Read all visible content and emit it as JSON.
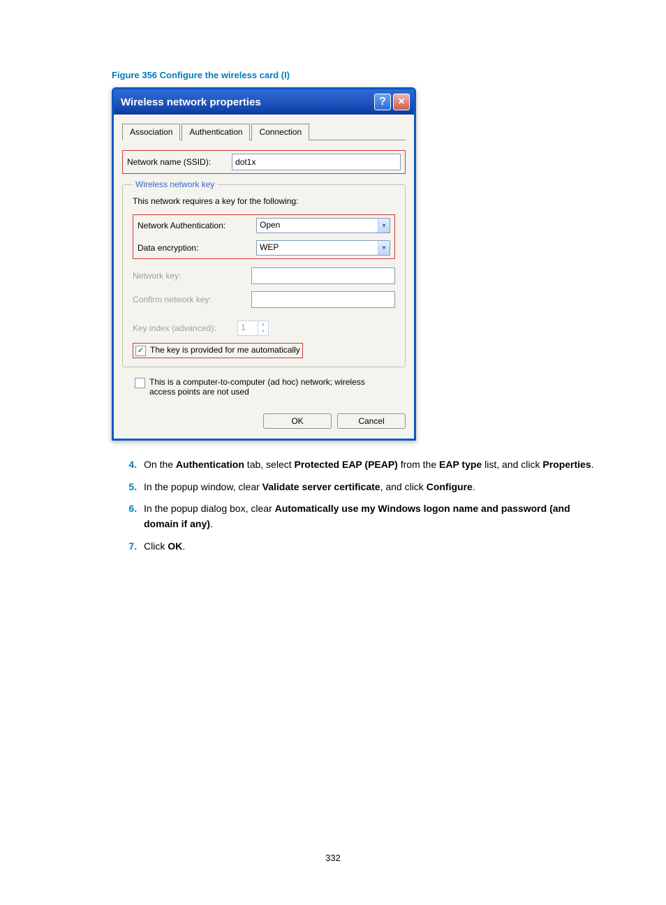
{
  "figure_caption": "Figure 356 Configure the wireless card (I)",
  "dialog": {
    "title": "Wireless network properties",
    "tabs": [
      "Association",
      "Authentication",
      "Connection"
    ],
    "ssid_label": "Network name (SSID):",
    "ssid_value": "dot1x",
    "group_title": "Wireless network key",
    "group_text": "This network requires a key for the following:",
    "auth_label": "Network Authentication:",
    "auth_value": "Open",
    "enc_label": "Data encryption:",
    "enc_value": "WEP",
    "key_label": "Network key:",
    "confirm_label": "Confirm network key:",
    "keyindex_label": "Key index (advanced):",
    "keyindex_value": "1",
    "autokey_label": "The key is provided for me automatically",
    "adhoc_label": "This is a computer-to-computer (ad hoc) network; wireless access points are not used",
    "ok_label": "OK",
    "cancel_label": "Cancel"
  },
  "steps": {
    "s4_a": "On the ",
    "s4_b": "Authentication",
    "s4_c": " tab, select ",
    "s4_d": "Protected EAP (PEAP)",
    "s4_e": " from the ",
    "s4_f": "EAP type",
    "s4_g": " list, and click ",
    "s4_h": "Properties",
    "s4_i": ".",
    "s5_a": "In the popup window, clear ",
    "s5_b": "Validate server certificate",
    "s5_c": ", and click ",
    "s5_d": "Configure",
    "s5_e": ".",
    "s6_a": "In the popup dialog box, clear ",
    "s6_b": "Automatically use my Windows logon name and password (and domain if any)",
    "s6_c": ".",
    "s7_a": "Click ",
    "s7_b": "OK",
    "s7_c": "."
  },
  "page_number": "332"
}
